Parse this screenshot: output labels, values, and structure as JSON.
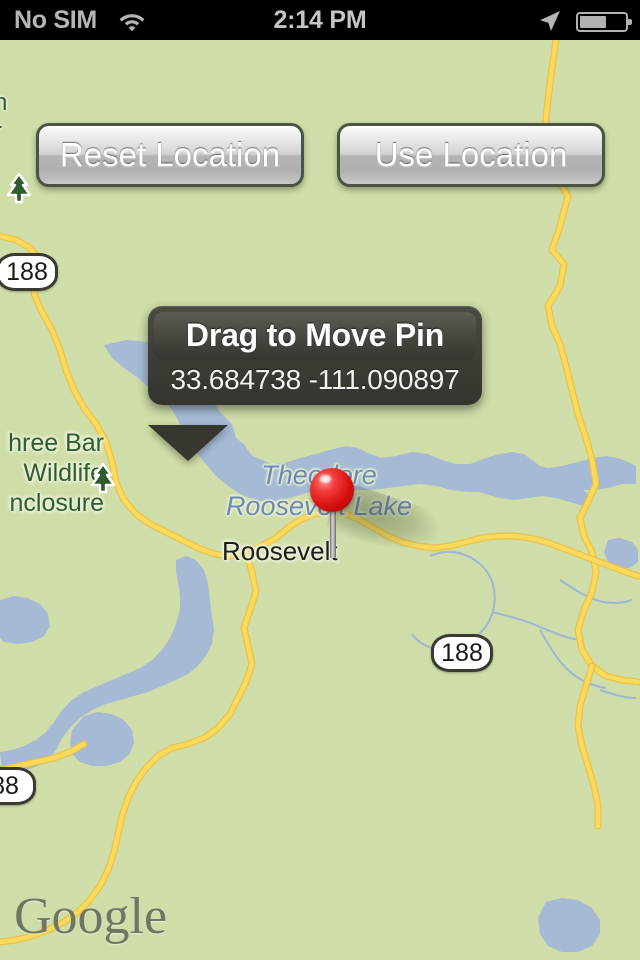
{
  "status_bar": {
    "carrier": "No SIM",
    "time": "2:14 PM",
    "wifi_icon": "wifi-icon",
    "location_icon": "location-arrow-icon",
    "battery_icon": "battery-icon"
  },
  "toolbar": {
    "reset_label": "Reset Location",
    "use_label": "Use Location"
  },
  "callout": {
    "title": "Drag to Move Pin",
    "coordinates": "33.684738 -111.090897",
    "latitude": "33.684738",
    "longitude": "-111.090897"
  },
  "map": {
    "provider_watermark": "Google",
    "labels": {
      "lake_line1": "Theodore",
      "lake_line2": "Roosevelt Lake",
      "town": "Roosevelt",
      "park_line1": "hree Bar",
      "park_line2": "Wildlife",
      "park_line3": "nclosure",
      "clipped_top_line1": "n",
      "clipped_top_line2": "r"
    },
    "shields": [
      {
        "label": "188"
      },
      {
        "label": "188"
      },
      {
        "label": "88"
      }
    ],
    "colors": {
      "land": "#cfdda8",
      "water": "#a6bad6",
      "road": "#fbd95b",
      "road_casing": "#e8c24a",
      "stream": "#9fb6d4",
      "label_water": "#6e89b3",
      "label_park": "#2f5c2f",
      "pin": "#d50d0d"
    }
  }
}
